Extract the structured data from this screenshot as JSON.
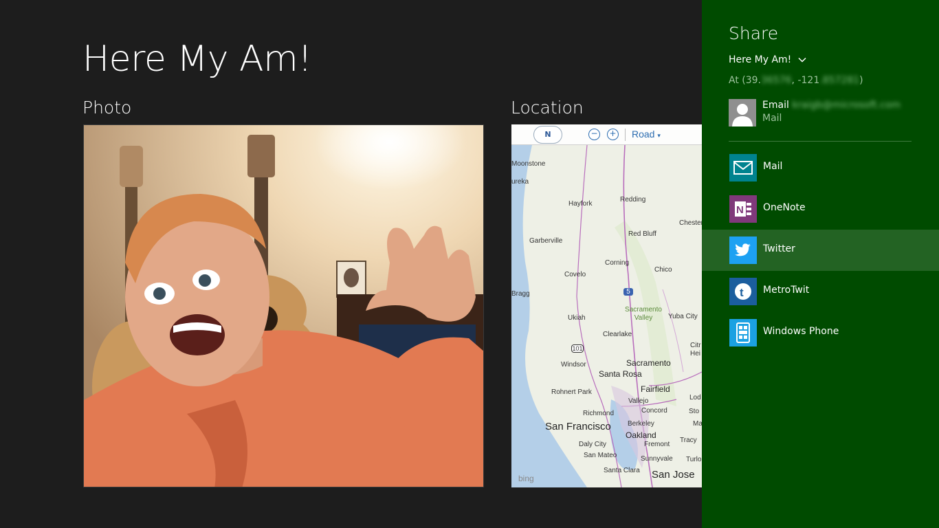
{
  "app": {
    "title": "Here My Am!",
    "photo_label": "Photo",
    "location_label": "Location"
  },
  "map": {
    "compass": "N",
    "road_select": "Road",
    "logo": "bing",
    "labels": {
      "moonstone": "Moonstone",
      "eureka": "ureka",
      "hayfork": "Hayfork",
      "redding": "Redding",
      "chester": "Chester",
      "garberville": "Garberville",
      "red_bluff": "Red Bluff",
      "corning": "Corning",
      "chico": "Chico",
      "covelo": "Covelo",
      "bragg": "Bragg",
      "i5": "5",
      "sacramento_valley": "Sacramento Valley",
      "ukiah": "Ukiah",
      "yuba_city": "Yuba City",
      "clearlake": "Clearlake",
      "citrus": "Citr",
      "heights": "Hei",
      "us101": "101",
      "windsor": "Windsor",
      "sacramento": "Sacramento",
      "santa_rosa": "Santa Rosa",
      "fairfield": "Fairfield",
      "rohnert_park": "Rohnert Park",
      "lodi": "Lod",
      "vallejo": "Vallejo",
      "richmond": "Richmond",
      "concord": "Concord",
      "stockton": "Sto",
      "san_francisco": "San Francisco",
      "berkeley": "Berkeley",
      "oakland": "Oakland",
      "tracy": "Tracy",
      "ma": "Ma",
      "daly_city": "Daly City",
      "fremont": "Fremont",
      "san_mateo": "San Mateo",
      "sunnyvale": "Sunnyvale",
      "turlock": "Turlo",
      "santa_clara": "Santa Clara",
      "san_jose": "San Jose"
    }
  },
  "share": {
    "title": "Share",
    "source": "Here My Am!",
    "coords_prefix": "At (39.",
    "coords_lat_hidden": "36576",
    "coords_mid": ", -121",
    "coords_lon_hidden": ".857281",
    "coords_suffix": ")",
    "quicklink_title": "Email",
    "quicklink_address": "kraigb@microsoft.com",
    "quicklink_app": "Mail",
    "targets": [
      {
        "label": "Mail",
        "icon": "mail-icon",
        "color": "#00838f"
      },
      {
        "label": "OneNote",
        "icon": "onenote-icon",
        "color": "#80397b"
      },
      {
        "label": "Twitter",
        "icon": "twitter-icon",
        "color": "#1da1f2"
      },
      {
        "label": "MetroTwit",
        "icon": "metrotwit-icon",
        "color": "#1b5e9e"
      },
      {
        "label": "Windows Phone",
        "icon": "windows-phone-icon",
        "color": "#1ba1e2"
      }
    ]
  },
  "colors": {
    "background": "#1d1d1d",
    "share_pane": "#004b00",
    "share_highlight": "#236323"
  }
}
